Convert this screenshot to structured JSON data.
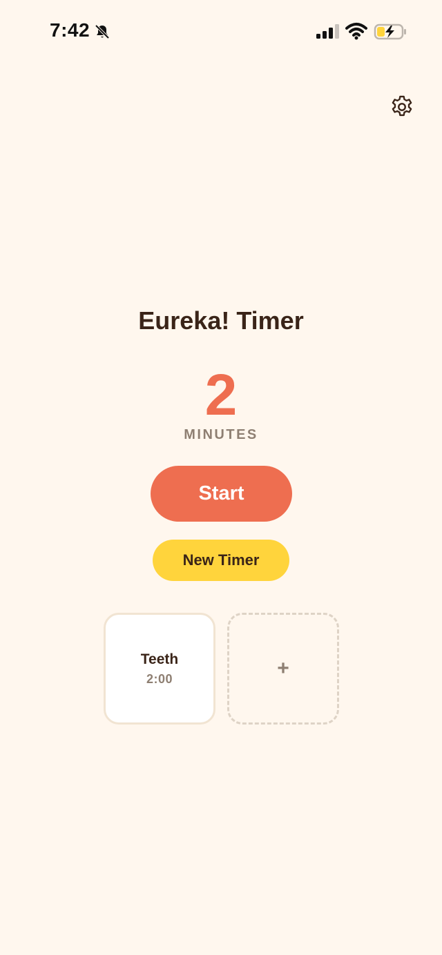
{
  "status_bar": {
    "time": "7:42",
    "icons": [
      "bell-slash-icon",
      "signal-icon",
      "wifi-icon",
      "battery-charging-icon"
    ]
  },
  "header": {
    "settings_icon": "gear-icon"
  },
  "main": {
    "title": "Eureka! Timer",
    "minutes_value": "2",
    "minutes_label": "MINUTES",
    "start_label": "Start",
    "new_timer_label": "New Timer"
  },
  "timers": [
    {
      "name": "Teeth",
      "duration": "2:00"
    }
  ],
  "add_card": {
    "icon": "plus-icon",
    "symbol": "+"
  },
  "colors": {
    "background": "#FFF7EE",
    "accent": "#EE6E50",
    "secondary": "#FFD43C",
    "text": "#3A2418",
    "muted": "#8E7F72"
  }
}
